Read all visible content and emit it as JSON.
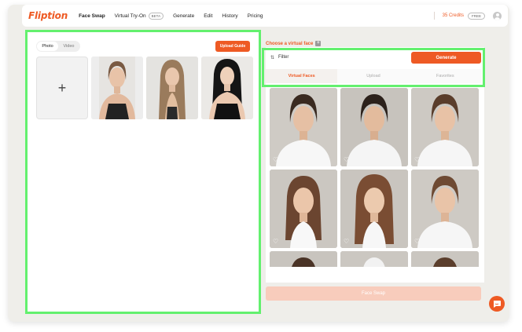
{
  "nav": {
    "logo": "Fliption",
    "links": [
      {
        "label": "Face Swap",
        "active": true
      },
      {
        "label": "Virtual Try-On",
        "badge": "BETA"
      },
      {
        "label": "Generate"
      },
      {
        "label": "Edit"
      },
      {
        "label": "History"
      },
      {
        "label": "Pricing"
      }
    ],
    "credits": "35 Credits",
    "plan_badge": "FREE"
  },
  "left": {
    "tabs": [
      "Photo",
      "Video"
    ],
    "upload_guide": "Upload Guide",
    "add_symbol": "+",
    "photos": [
      "photo-1",
      "photo-2",
      "photo-3"
    ]
  },
  "right": {
    "heading": "Choose a virtual face",
    "filter_label": "Filter",
    "generate_label": "Generate",
    "subtabs": [
      "Virtual Faces",
      "Upload",
      "Favorites"
    ],
    "face_swap_label": "Face Swap"
  },
  "colors": {
    "accent": "#ee5a24",
    "highlight": "#63f06e"
  }
}
